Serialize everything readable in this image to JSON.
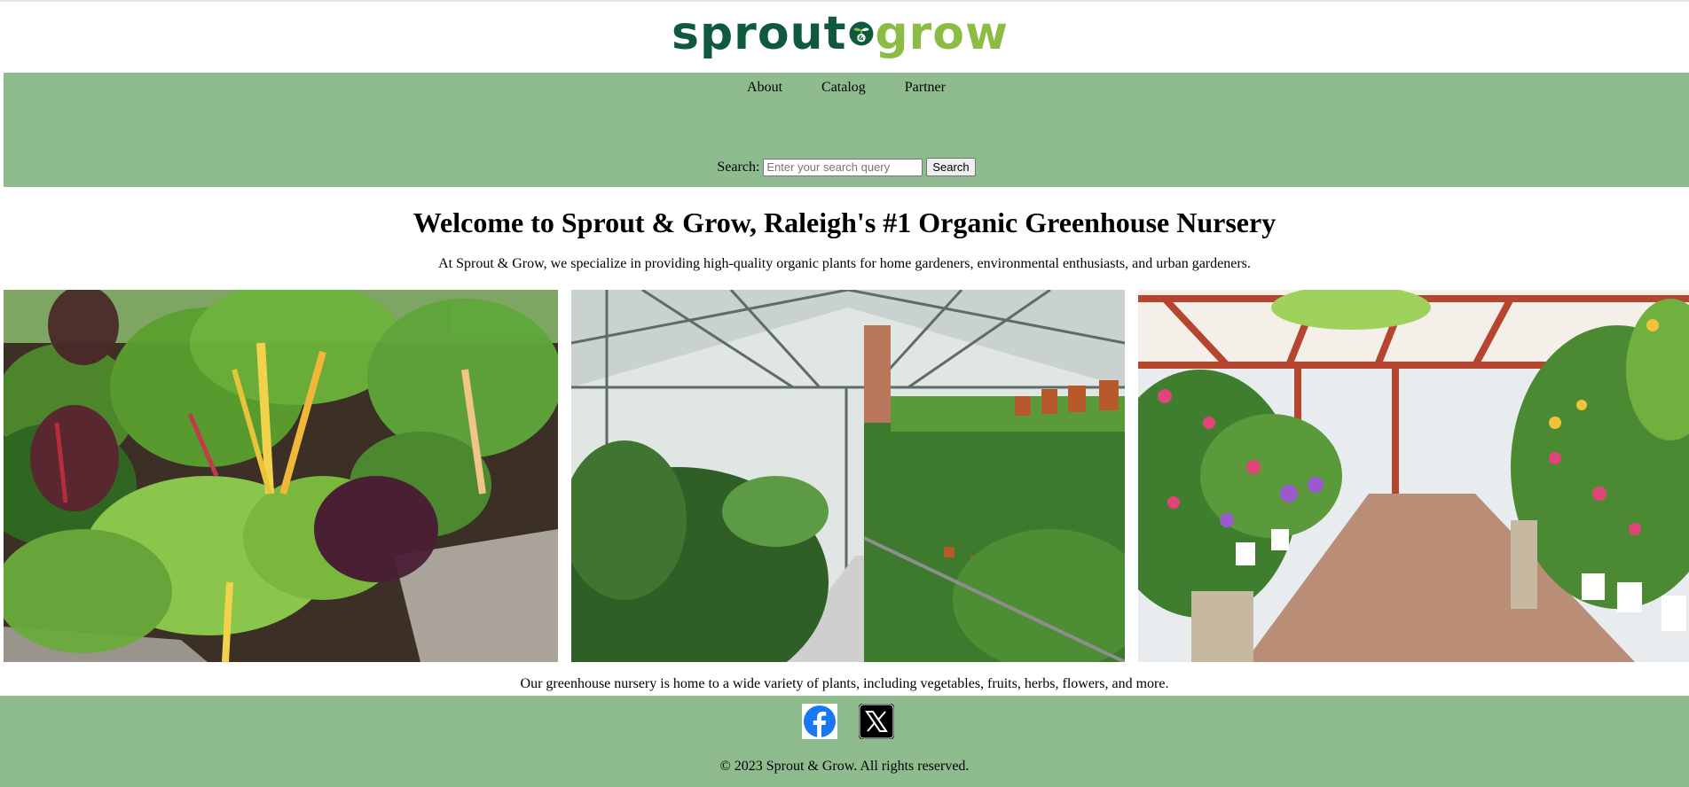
{
  "logo": {
    "word1": "sprout",
    "mark": "&",
    "word2": "grow",
    "brand_dark": "#0f5a3d",
    "brand_light": "#8bbd45"
  },
  "nav": {
    "items": [
      {
        "label": "About"
      },
      {
        "label": "Catalog"
      },
      {
        "label": "Partner"
      }
    ],
    "background": "#8fbc8f"
  },
  "search": {
    "label": "Search:",
    "placeholder": "Enter your search query",
    "button_label": "Search"
  },
  "main": {
    "headline": "Welcome to Sprout & Grow, Raleigh's #1 Organic Greenhouse Nursery",
    "intro": "At Sprout & Grow, we specialize in providing high-quality organic plants for home gardeners, environmental enthusiasts, and urban gardeners.",
    "photos": [
      {
        "subject": "raised bed with rainbow chard"
      },
      {
        "subject": "glass greenhouse interior with potted plants"
      },
      {
        "subject": "garden center with flowering plants"
      }
    ],
    "variety": "Our greenhouse nursery is home to a wide variety of plants, including vegetables, fruits, herbs, flowers, and more."
  },
  "footer": {
    "social": [
      {
        "icon": "facebook-icon",
        "color": "#1877f2"
      },
      {
        "icon": "x-twitter-icon",
        "color": "#000000"
      }
    ],
    "copyright": "© 2023 Sprout & Grow. All rights reserved."
  }
}
